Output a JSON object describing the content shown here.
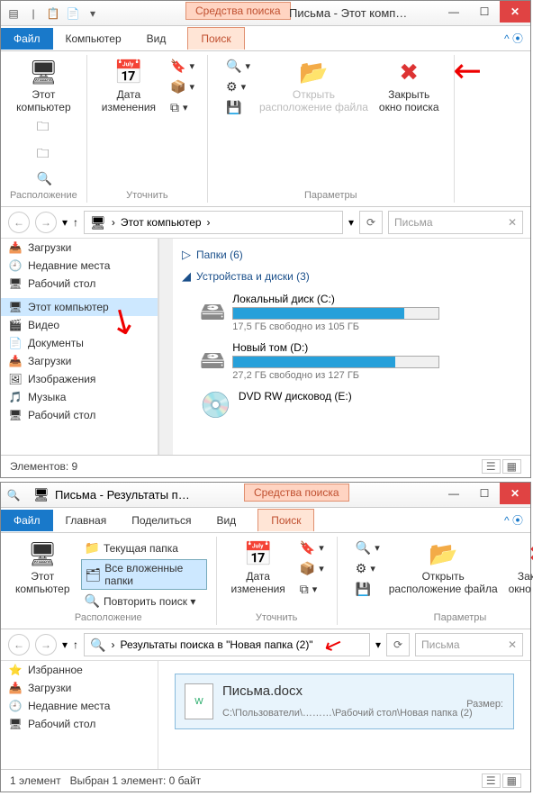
{
  "win1": {
    "searchTools": "Средства поиска",
    "title": "Письма - Этот комп…",
    "tabs": {
      "file": "Файл",
      "computer": "Компьютер",
      "view": "Вид",
      "search": "Поиск"
    },
    "ribbon": {
      "thisPc": "Этот\nкомпьютер",
      "date": "Дата\nизменения",
      "open": "Открыть\nрасположение файла",
      "close": "Закрыть\nокно поиска",
      "gLoc": "Расположение",
      "gRefine": "Уточнить",
      "gParams": "Параметры"
    },
    "address": "Этот компьютер",
    "searchValue": "Письма",
    "nav": [
      {
        "icon": "📥",
        "label": "Загрузки"
      },
      {
        "icon": "🕘",
        "label": "Недавние места"
      },
      {
        "icon": "🖥",
        "label": "Рабочий стол"
      },
      {
        "icon": "",
        "label": ""
      },
      {
        "icon": "🖥",
        "label": "Этот компьютер",
        "sel": true
      },
      {
        "icon": "🎬",
        "label": "Видео"
      },
      {
        "icon": "📄",
        "label": "Документы"
      },
      {
        "icon": "📥",
        "label": "Загрузки"
      },
      {
        "icon": "🖼",
        "label": "Изображения"
      },
      {
        "icon": "🎵",
        "label": "Музыка"
      },
      {
        "icon": "🖥",
        "label": "Рабочий стол"
      }
    ],
    "folders": "Папки (6)",
    "devices": "Устройства и диски (3)",
    "drives": [
      {
        "name": "Локальный диск (C:)",
        "free": "17,5 ГБ свободно из 105 ГБ",
        "pct": 83
      },
      {
        "name": "Новый том (D:)",
        "free": "27,2 ГБ свободно из 127 ГБ",
        "pct": 79
      }
    ],
    "dvd": "DVD RW дисковод (E:)",
    "status": "Элементов: 9"
  },
  "win2": {
    "title": "Письма - Результаты п…",
    "searchTools": "Средства поиска",
    "tabs": {
      "file": "Файл",
      "home": "Главная",
      "share": "Поделиться",
      "view": "Вид",
      "search": "Поиск"
    },
    "ribbon": {
      "thisPc": "Этот\nкомпьютер",
      "cur": "Текущая папка",
      "sub": "Все вложенные папки",
      "again": "Повторить поиск ▾",
      "date": "Дата\nизменения",
      "open": "Открыть\nрасположение файла",
      "close": "Закрыть\nокно поиска",
      "gLoc": "Расположение",
      "gRefine": "Уточнить",
      "gParams": "Параметры"
    },
    "address": "Результаты поиска в \"Новая папка (2)\"",
    "searchValue": "Письма",
    "nav": [
      {
        "icon": "⭐",
        "label": "Избранное",
        "bold": true
      },
      {
        "icon": "📥",
        "label": "Загрузки"
      },
      {
        "icon": "🕘",
        "label": "Недавние места"
      },
      {
        "icon": "🖥",
        "label": "Рабочий стол"
      }
    ],
    "result": {
      "name": "Письма.docx",
      "size": "Размер:",
      "path": "C:\\Пользователи\\………\\Рабочий стол\\Новая папка (2)"
    },
    "status": "1 элемент",
    "status2": "Выбран 1 элемент: 0 байт"
  }
}
